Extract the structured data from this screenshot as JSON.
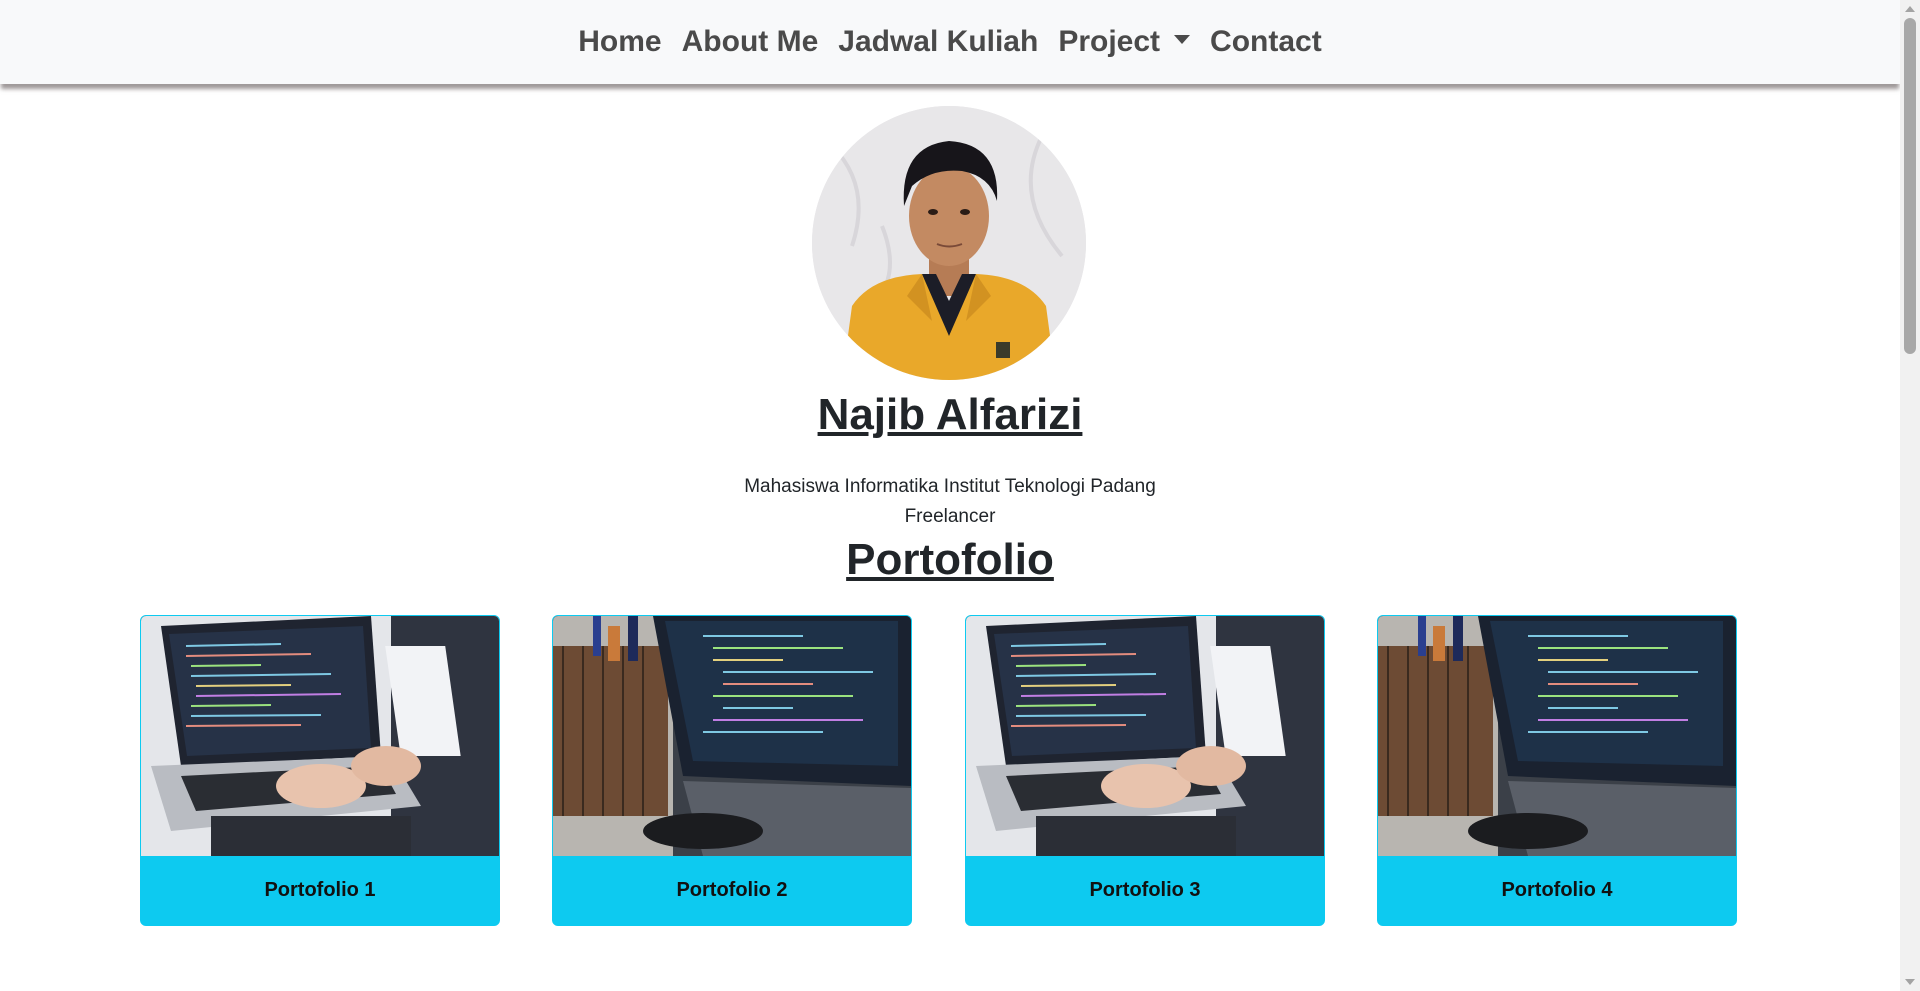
{
  "navbar": {
    "items": [
      {
        "label": "Home"
      },
      {
        "label": "About Me"
      },
      {
        "label": "Jadwal Kuliah"
      },
      {
        "label": "Project",
        "dropdown": true
      },
      {
        "label": "Contact"
      }
    ]
  },
  "profile": {
    "name": "Najib Alfarizi",
    "description_lines": [
      "Mahasiswa Informatika Institut Teknologi Padang",
      "Freelancer"
    ]
  },
  "portfolio": {
    "title": "Portofolio",
    "cards": [
      {
        "label": "Portofolio 1",
        "image": "laptop-coding-photo"
      },
      {
        "label": "Portofolio 2",
        "image": "laptop-code-desk-photo"
      },
      {
        "label": "Portofolio 3",
        "image": "laptop-coding-photo"
      },
      {
        "label": "Portofolio 4",
        "image": "laptop-code-desk-photo"
      }
    ]
  },
  "colors": {
    "navbar_bg": "#f8f9fa",
    "card_accent": "#0dcaf0",
    "text": "#212529"
  }
}
